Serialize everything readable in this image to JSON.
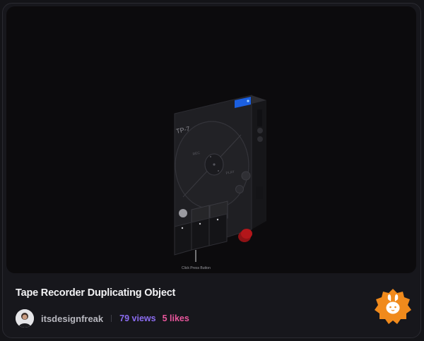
{
  "project": {
    "title": "Tape Recorder Duplicating Object",
    "author": "itsdesignfreak",
    "views": "79 views",
    "likes": "5 likes"
  },
  "device": {
    "model_label": "TP-7",
    "callout_label": "Click Press Button",
    "dial_left_label": "REC",
    "dial_right_label": "PLAY"
  },
  "badge": {
    "icon": "bunny-icon",
    "color": "#f08a1c"
  },
  "colors": {
    "background": "#0c0b0d",
    "card": "#17171c",
    "views": "#8b6cf0",
    "likes": "#e9569c",
    "accent": "#b3161a"
  }
}
